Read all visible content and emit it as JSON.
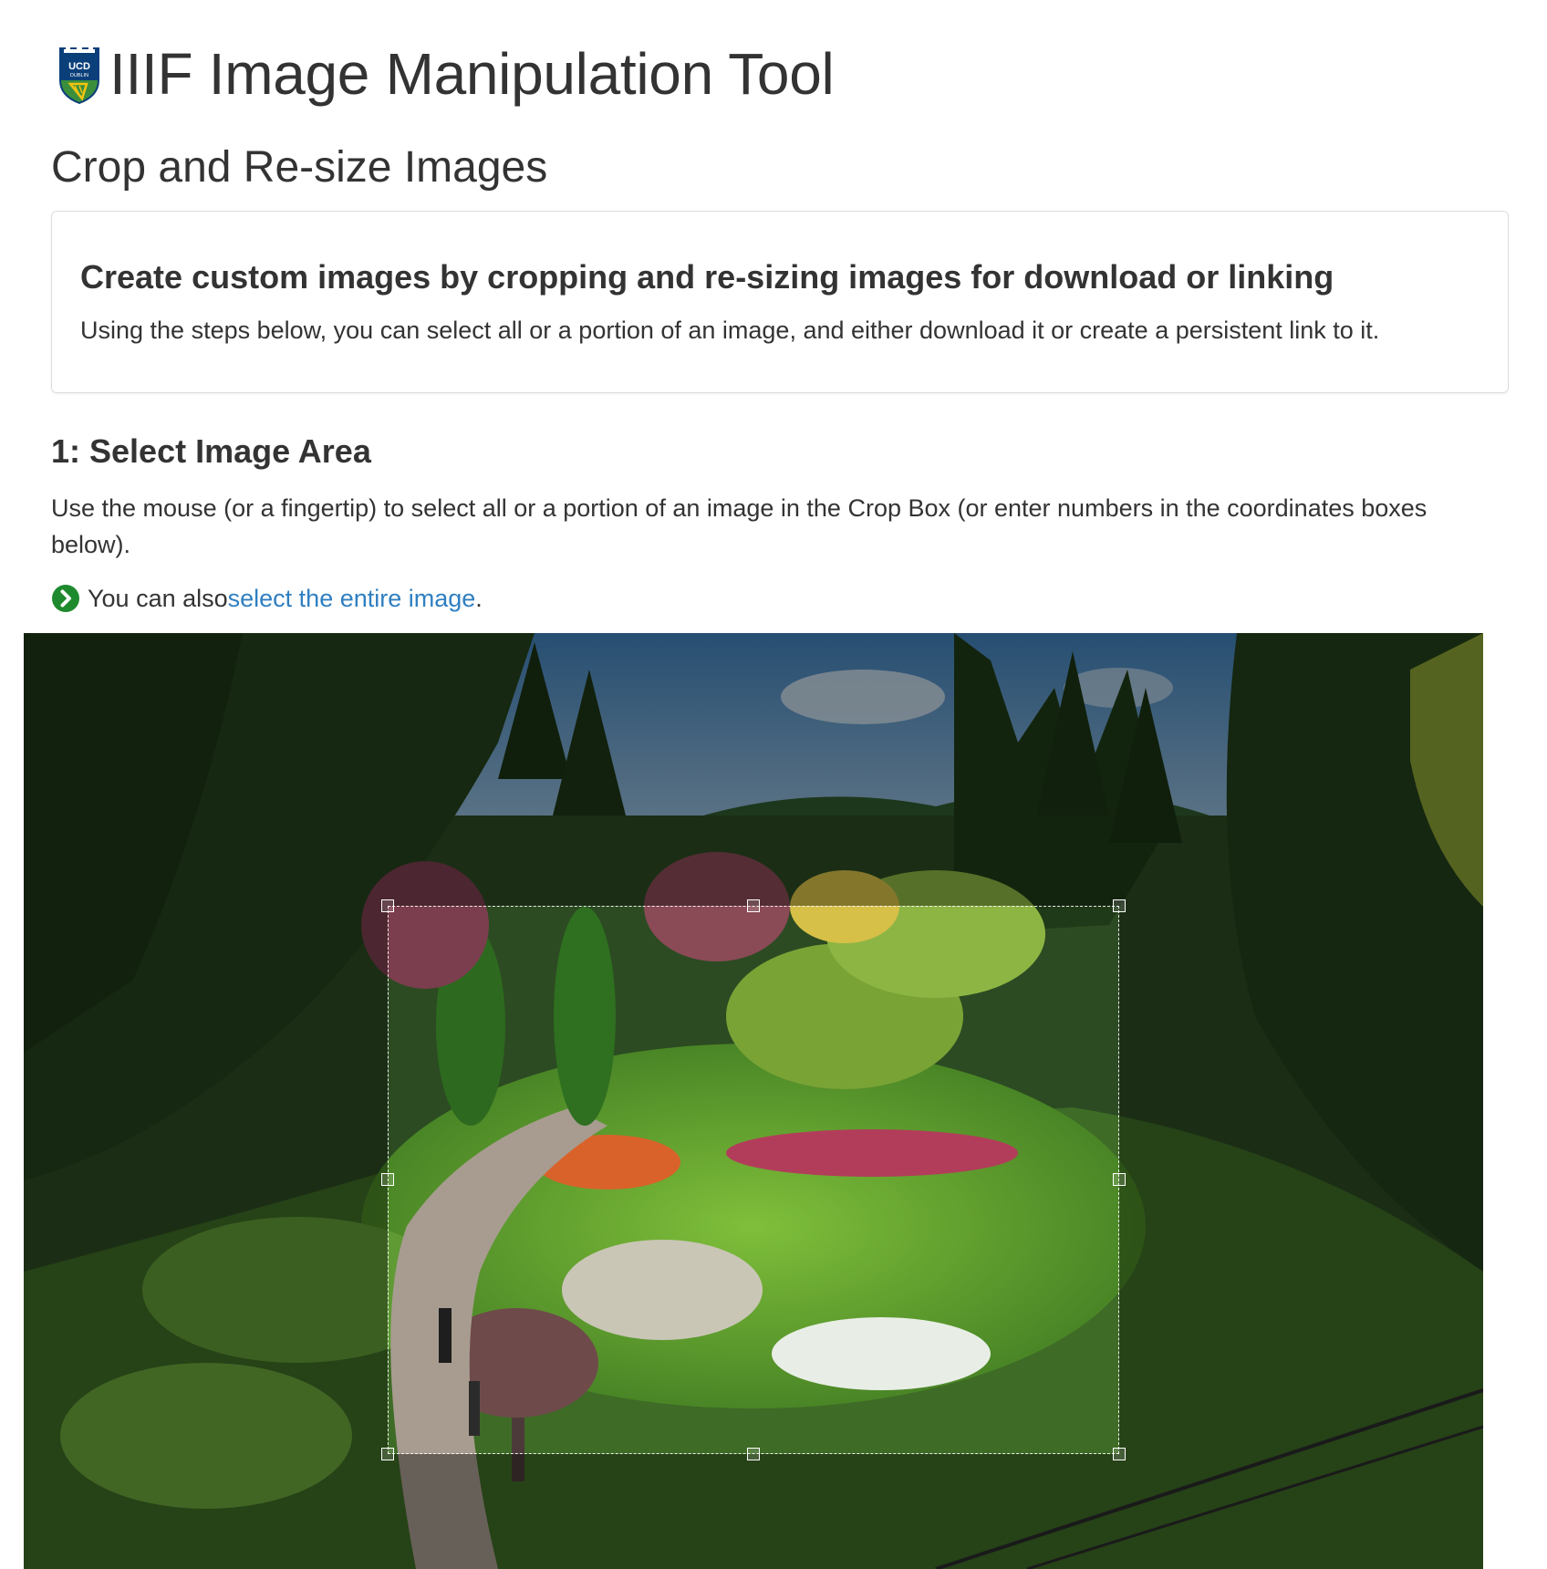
{
  "header": {
    "logo_icon": "ucd-crest-icon",
    "logo_text_top": "UCD",
    "logo_text_bottom": "DUBLIN",
    "title": "IIIF Image Manipulation Tool"
  },
  "page_title": "Crop and Re-size Images",
  "intro_panel": {
    "heading": "Create custom images by cropping and re-sizing images for download or linking",
    "text": "Using the steps below, you can select all or a portion of an image, and either download it or create a persistent link to it."
  },
  "step1": {
    "heading": "1: Select Image Area",
    "instructions": "Use the mouse (or a fingertip) to select all or a portion of an image in the Crop Box (or enter numbers in the coordinates boxes below).",
    "also_prefix": "You can also ",
    "select_entire_link": "select the entire image",
    "also_suffix": ".",
    "go_icon": "chevron-right-circle-icon"
  },
  "colors": {
    "link": "#2f7fc1",
    "go_icon": "#1e8a2e",
    "text": "#333333"
  }
}
